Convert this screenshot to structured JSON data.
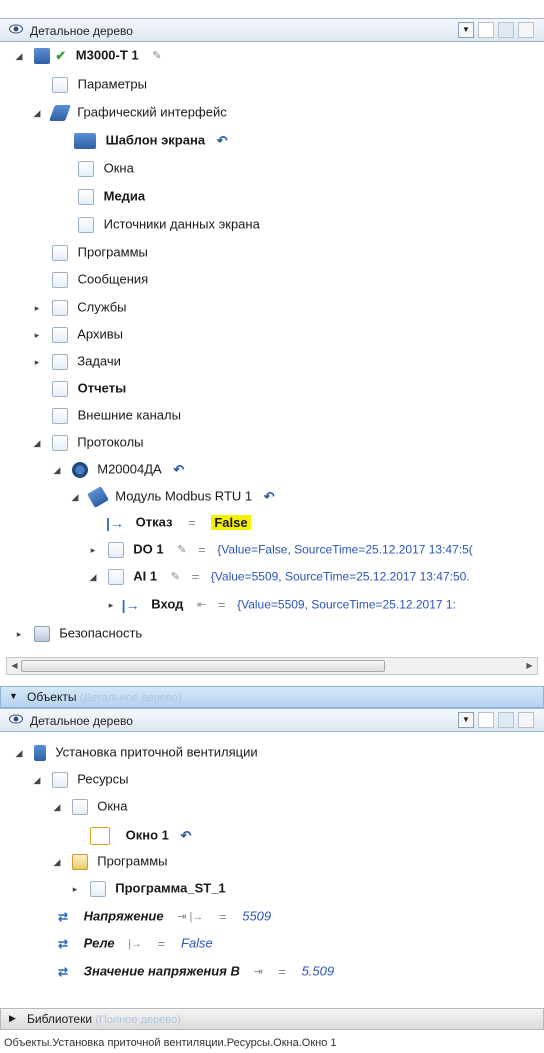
{
  "top_panel": {
    "header": {
      "title": "Детальное дерево"
    },
    "tree": [
      {
        "label": "M3000-T 1",
        "bold": true
      },
      {
        "label": "Параметры"
      },
      {
        "label": "Графический интерфейс"
      },
      {
        "label": "Шаблон экрана",
        "bold": true
      },
      {
        "label": "Окна"
      },
      {
        "label": "Медиа",
        "bold": true
      },
      {
        "label": "Источники данных экрана"
      },
      {
        "label": "Программы"
      },
      {
        "label": "Сообщения"
      },
      {
        "label": "Службы"
      },
      {
        "label": "Архивы"
      },
      {
        "label": "Задачи"
      },
      {
        "label": "Отчеты",
        "bold": true
      },
      {
        "label": "Внешние каналы"
      },
      {
        "label": "Протоколы"
      },
      {
        "label": "M20004ДА"
      },
      {
        "label": "Модуль Modbus RTU 1"
      },
      {
        "label": "Отказ",
        "bold": true,
        "eq": "=",
        "value": "False"
      },
      {
        "label": "DO 1",
        "bold": true,
        "eq": "=",
        "value": "{Value=False, SourceTime=25.12.2017 13:47:5("
      },
      {
        "label": "AI 1",
        "bold": true,
        "eq": "=",
        "value": "{Value=5509, SourceTime=25.12.2017 13:47:50."
      },
      {
        "label": "Вход",
        "bold": true,
        "eq": "=",
        "value": "{Value=5509, SourceTime=25.12.2017 1:"
      },
      {
        "label": "Безопасность"
      }
    ]
  },
  "objects_section": {
    "label": "Объекты",
    "sub": "(Детальное дерево)"
  },
  "bottom_panel": {
    "header": {
      "title": "Детальное дерево"
    },
    "tree": [
      {
        "label": "Установка приточной вентиляции"
      },
      {
        "label": "Ресурсы"
      },
      {
        "label": "Окна"
      },
      {
        "label": "Окно 1",
        "bold": true
      },
      {
        "label": "Программы"
      },
      {
        "label": "Программа_ST_1",
        "bold": true
      },
      {
        "label": "Напряжение",
        "eq": "=",
        "value": "5509"
      },
      {
        "label": "Реле",
        "eq": "=",
        "value": "False"
      },
      {
        "label": "Значение напряжения В",
        "eq": "=",
        "value": "5.509"
      }
    ]
  },
  "libraries_section": {
    "label": "Библиотеки",
    "sub": "(Полное дерево)"
  },
  "status_bar": "Объекты.Установка приточной вентиляции.Ресурсы.Окна.Окно 1"
}
